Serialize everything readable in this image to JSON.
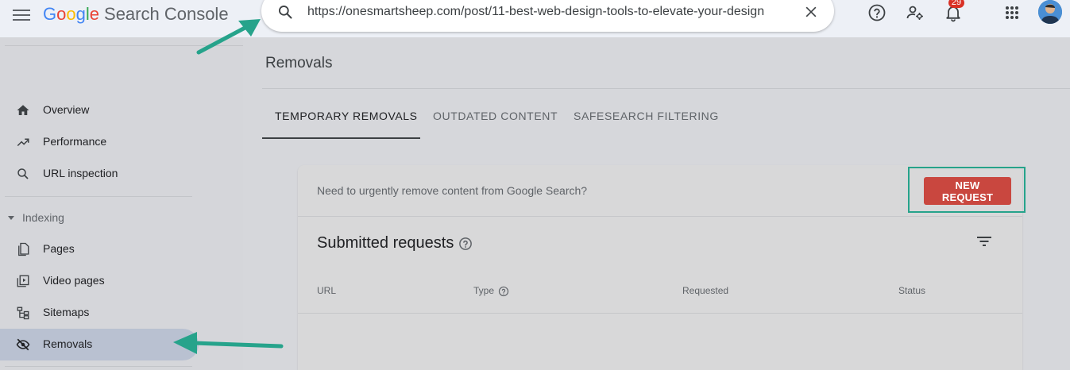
{
  "header": {
    "logo": {
      "g1": "G",
      "o1": "o",
      "o2": "o",
      "g2": "g",
      "l": "l",
      "e": "e",
      "product": "Search Console"
    },
    "search": {
      "value": "https://onesmartsheep.com/post/11-best-web-design-tools-to-elevate-your-design"
    },
    "notifications_count": "29",
    "icons": [
      "menu-icon",
      "search-icon",
      "close-icon",
      "help-icon",
      "manage-users-icon",
      "bell-icon",
      "apps-icon"
    ]
  },
  "sidebar": {
    "items_top": [
      {
        "label": "Overview",
        "icon": "home-icon"
      },
      {
        "label": "Performance",
        "icon": "trending-icon"
      },
      {
        "label": "URL inspection",
        "icon": "search-icon"
      }
    ],
    "section": "Indexing",
    "items_indexing": [
      {
        "label": "Pages",
        "icon": "pages-icon"
      },
      {
        "label": "Video pages",
        "icon": "video-icon"
      },
      {
        "label": "Sitemaps",
        "icon": "sitemap-icon"
      },
      {
        "label": "Removals",
        "icon": "eye-off-icon"
      }
    ],
    "active": "Removals"
  },
  "main": {
    "title": "Removals",
    "tabs": [
      {
        "label": "TEMPORARY REMOVALS",
        "active": true
      },
      {
        "label": "OUTDATED CONTENT",
        "active": false
      },
      {
        "label": "SAFESEARCH FILTERING",
        "active": false
      }
    ],
    "card": {
      "message": "Need to urgently remove content from Google Search?",
      "button": "NEW REQUEST",
      "subtitle": "Submitted requests",
      "columns": [
        "URL",
        "Type",
        "Requested",
        "Status"
      ]
    }
  },
  "colors": {
    "accent_red": "#c9473f",
    "annotation_green": "#26a38b",
    "active_nav": "#b9c1d1"
  }
}
